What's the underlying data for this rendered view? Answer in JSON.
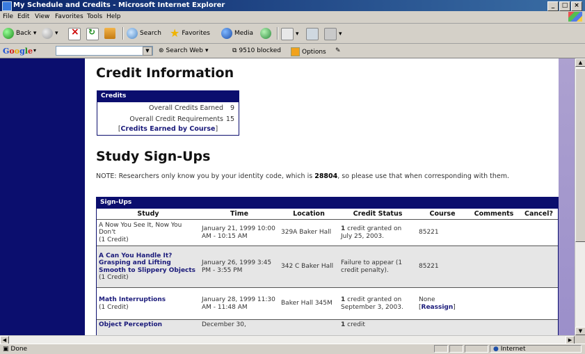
{
  "window": {
    "title": "My Schedule and Credits - Microsoft Internet Explorer",
    "controls": [
      "_",
      "□",
      "×"
    ]
  },
  "menu": [
    "File",
    "Edit",
    "View",
    "Favorites",
    "Tools",
    "Help"
  ],
  "toolbar": {
    "back": "Back",
    "search": "Search",
    "favorites": "Favorites",
    "media": "Media"
  },
  "google": {
    "logo": "Google",
    "search_web": "Search Web",
    "blocked": "9510 blocked",
    "options": "Options"
  },
  "page": {
    "credit_heading": "Credit Information",
    "credits": {
      "header": "Credits",
      "rows": [
        {
          "label": "Overall Credits Earned",
          "value": "9"
        },
        {
          "label": "Overall Credit Requirements",
          "value": "15"
        }
      ],
      "link": "Credits Earned by Course"
    },
    "study_heading": "Study Sign-Ups",
    "note_prefix": "NOTE: Researchers only know you by your identity code, which is ",
    "identity_code": "28804",
    "note_suffix": ", so please use that when corresponding with them.",
    "signups": {
      "caption": "Sign-Ups",
      "columns": [
        "Study",
        "Time",
        "Location",
        "Credit Status",
        "Course",
        "Comments",
        "Cancel?"
      ],
      "rows": [
        {
          "study": "A Now You See It, Now You Don't",
          "study_credit": "(1 Credit)",
          "time": "January 21, 1999 10:00 AM - 10:15 AM",
          "location": "329A Baker Hall",
          "status_num": "1",
          "status": " credit granted on July 25, 2003.",
          "course": "85221",
          "comments": "",
          "reassign": ""
        },
        {
          "study": "A Can You Handle It? Grasping and Lifting Smooth to Slippery Objects",
          "study_credit": "(1 Credit)",
          "time": "January 26, 1999 3:45 PM - 3:55 PM",
          "location": "342 C Baker Hall",
          "status_num": "",
          "status": "Failure to appear (1 credit penalty).",
          "course": "85221",
          "comments": "",
          "reassign": ""
        },
        {
          "study": "Math Interruptions",
          "study_credit": "(1 Credit)",
          "time": "January 28, 1999 11:30 AM - 11:48 AM",
          "location": "Baker Hall 345M",
          "status_num": "1",
          "status": " credit granted on September 3, 2003.",
          "course": "None",
          "comments": "",
          "reassign": "Reassign"
        },
        {
          "study": "Object Perception",
          "study_credit": "",
          "time": "December 30,",
          "location": "",
          "status_num": "1",
          "status": " credit",
          "course": "",
          "comments": "",
          "reassign": ""
        }
      ]
    }
  },
  "status": {
    "left": "Done",
    "zone": "Internet"
  }
}
